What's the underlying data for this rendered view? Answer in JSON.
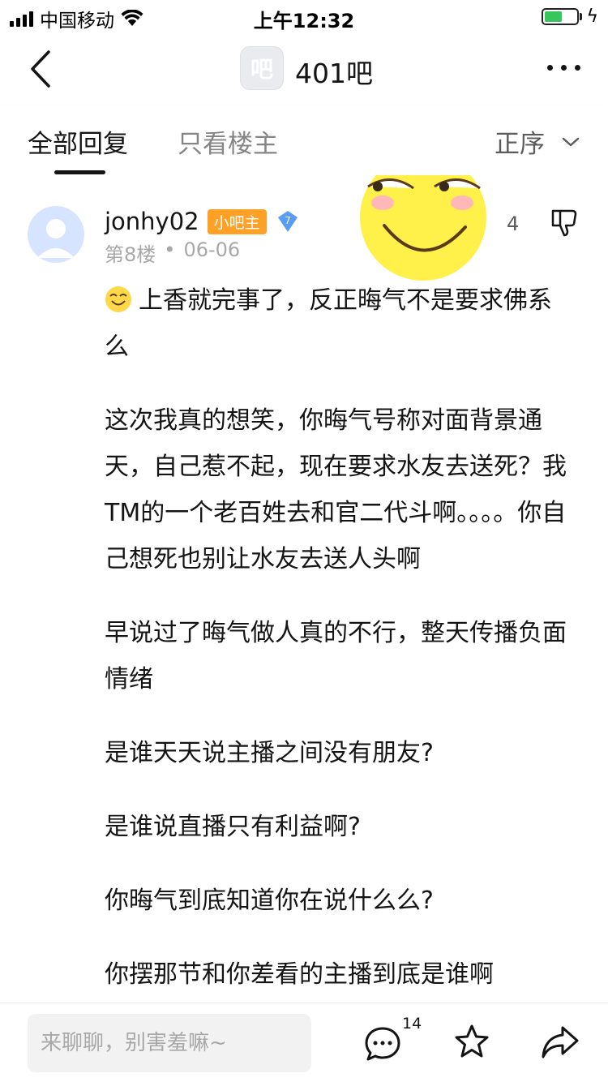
{
  "status_bar": {
    "carrier": "中国移动",
    "time": "上午12:32"
  },
  "nav": {
    "forum_logo": "吧",
    "forum_name": "401吧"
  },
  "tabs": {
    "all_replies": "全部回复",
    "owner_only": "只看楼主",
    "sort_label": "正序"
  },
  "post": {
    "author": "jonhy02",
    "role_badge": "小吧主",
    "level": "7",
    "floor": "第8楼",
    "separator": "•",
    "date": "06-06",
    "like_count": "4",
    "paragraphs": [
      "上香就完事了，反正晦气不是要求佛系么",
      "这次我真的想笑，你晦气号称对面背景通天，自己惹不起，现在要求水友去送死？我TM的一个老百姓去和官二代斗啊。。。。你自己想死也别让水友去送人头啊",
      "早说过了晦气做人真的不行，整天传播负面情绪",
      "是谁天天说主播之间没有朋友?",
      "是谁说直播只有利益啊?",
      "你晦气到底知道你在说什么么?",
      "你摆那节和你差看的主播到底是谁啊"
    ]
  },
  "bottom_bar": {
    "reply_placeholder": "来聊聊，别害羞嘛~",
    "comment_count": "14"
  },
  "colors": {
    "role_badge": "#ffa126",
    "level_badge": "#5b9cf5",
    "battery": "#35c759"
  }
}
